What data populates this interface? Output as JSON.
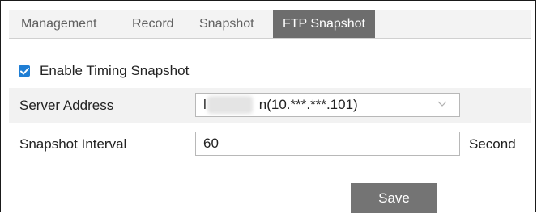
{
  "tabs": {
    "management": "Management",
    "record": "Record",
    "snapshot": "Snapshot",
    "ftp_snapshot": "FTP Snapshot",
    "active": "FTP Snapshot"
  },
  "timing_snapshot": {
    "label": "Enable Timing Snapshot",
    "checked": true
  },
  "server_address": {
    "label": "Server Address",
    "value": "n(10.***.***.101)"
  },
  "snapshot_interval": {
    "label": "Snapshot Interval",
    "value": "60",
    "unit": "Second"
  },
  "actions": {
    "save_label": "Save"
  },
  "colors": {
    "active_tab": "#6d6d6d",
    "checkbox": "#1f7ed4",
    "save_button": "#747474"
  },
  "icons": {
    "checkbox": "checkmark-icon",
    "select": "chevron-down-icon"
  }
}
